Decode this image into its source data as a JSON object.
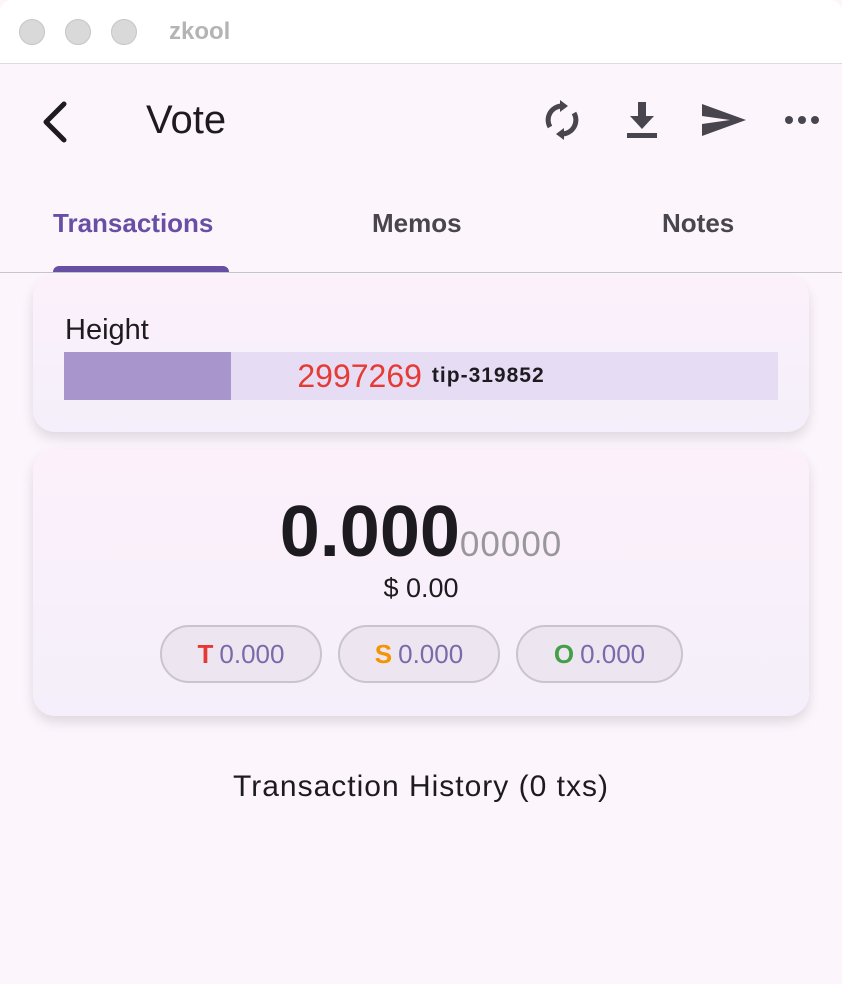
{
  "window": {
    "title": "zkool"
  },
  "appbar": {
    "title": "Vote",
    "icons": [
      "back-icon",
      "sync-icon",
      "download-icon",
      "send-icon",
      "more-icon"
    ]
  },
  "tabs": [
    {
      "label": "Transactions",
      "active": true
    },
    {
      "label": "Memos",
      "active": false
    },
    {
      "label": "Notes",
      "active": false
    }
  ],
  "height_card": {
    "label": "Height",
    "height": "2997269",
    "tip": "tip-319852",
    "progress_fraction": 0.234
  },
  "balance": {
    "main": "0.000",
    "sub": "00000",
    "fiat": "$ 0.00",
    "pools": [
      {
        "letter": "T",
        "amount": "0.000",
        "color": "#e53935"
      },
      {
        "letter": "S",
        "amount": "0.000",
        "color": "#f59300"
      },
      {
        "letter": "O",
        "amount": "0.000",
        "color": "#43a047"
      }
    ]
  },
  "history": {
    "label": "Transaction History (0 txs)"
  },
  "colors": {
    "accent": "#6750a4",
    "progress_fill": "#a795cc",
    "height_number": "#e63a34"
  }
}
